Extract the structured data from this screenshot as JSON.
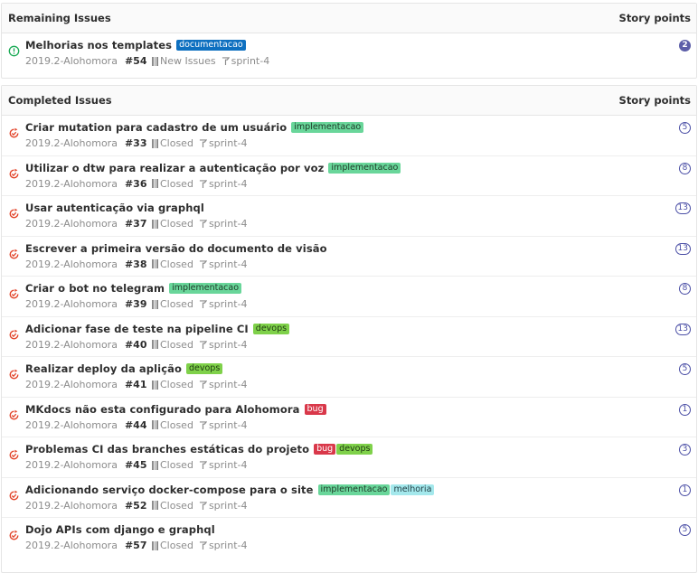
{
  "colors": {
    "open_icon": "#1aaa55",
    "closed_icon": "#e24329",
    "badge": "#4b4fa6"
  },
  "remaining": {
    "title": "Remaining Issues",
    "points_header": "Story points",
    "issues": [
      {
        "title": "Melhorias nos templates",
        "labels": [
          {
            "text": "documentacao",
            "bg": "#0e70c0",
            "fg": "#ffffff"
          }
        ],
        "milestone": "2019.2-Alohomora",
        "iid": "#54",
        "status": "New Issues",
        "sprint": "sprint-4",
        "points": "2"
      }
    ]
  },
  "completed": {
    "title": "Completed Issues",
    "points_header": "Story points",
    "issues": [
      {
        "title": "Criar mutation para cadastro de um usuário",
        "labels": [
          {
            "text": "implementacao",
            "bg": "#69d69a",
            "fg": "#1e3a28"
          }
        ],
        "milestone": "2019.2-Alohomora",
        "iid": "#33",
        "status": "Closed",
        "sprint": "sprint-4",
        "points": "5"
      },
      {
        "title": "Utilizar o dtw para realizar a autenticação por voz",
        "labels": [
          {
            "text": "implementacao",
            "bg": "#69d69a",
            "fg": "#1e3a28"
          }
        ],
        "milestone": "2019.2-Alohomora",
        "iid": "#36",
        "status": "Closed",
        "sprint": "sprint-4",
        "points": "8"
      },
      {
        "title": "Usar autenticação via graphql",
        "labels": [],
        "milestone": "2019.2-Alohomora",
        "iid": "#37",
        "status": "Closed",
        "sprint": "sprint-4",
        "points": "13"
      },
      {
        "title": "Escrever a primeira versão do documento de visão",
        "labels": [],
        "milestone": "2019.2-Alohomora",
        "iid": "#38",
        "status": "Closed",
        "sprint": "sprint-4",
        "points": "13"
      },
      {
        "title": "Criar o bot no telegram",
        "labels": [
          {
            "text": "implementacao",
            "bg": "#69d69a",
            "fg": "#1e3a28"
          }
        ],
        "milestone": "2019.2-Alohomora",
        "iid": "#39",
        "status": "Closed",
        "sprint": "sprint-4",
        "points": "8"
      },
      {
        "title": "Adicionar fase de teste na pipeline CI",
        "labels": [
          {
            "text": "devops",
            "bg": "#7fd14a",
            "fg": "#1e3a12"
          }
        ],
        "milestone": "2019.2-Alohomora",
        "iid": "#40",
        "status": "Closed",
        "sprint": "sprint-4",
        "points": "13"
      },
      {
        "title": "Realizar deploy da aplição",
        "labels": [
          {
            "text": "devops",
            "bg": "#7fd14a",
            "fg": "#1e3a12"
          }
        ],
        "milestone": "2019.2-Alohomora",
        "iid": "#41",
        "status": "Closed",
        "sprint": "sprint-4",
        "points": "5"
      },
      {
        "title": "MKdocs não esta configurado para Alohomora",
        "labels": [
          {
            "text": "bug",
            "bg": "#d9384a",
            "fg": "#ffffff"
          }
        ],
        "milestone": "2019.2-Alohomora",
        "iid": "#44",
        "status": "Closed",
        "sprint": "sprint-4",
        "points": "1"
      },
      {
        "title": "Problemas CI das branches estáticas do projeto",
        "labels": [
          {
            "text": "bug",
            "bg": "#d9384a",
            "fg": "#ffffff"
          },
          {
            "text": "devops",
            "bg": "#7fd14a",
            "fg": "#1e3a12"
          }
        ],
        "milestone": "2019.2-Alohomora",
        "iid": "#45",
        "status": "Closed",
        "sprint": "sprint-4",
        "points": "3"
      },
      {
        "title": "Adicionando serviço docker-compose para o site",
        "labels": [
          {
            "text": "implementacao",
            "bg": "#69d69a",
            "fg": "#1e3a28"
          },
          {
            "text": "melhoria",
            "bg": "#a4e8ec",
            "fg": "#1e3a40"
          }
        ],
        "milestone": "2019.2-Alohomora",
        "iid": "#52",
        "status": "Closed",
        "sprint": "sprint-4",
        "points": "1"
      },
      {
        "title": "Dojo APIs com django e graphql",
        "labels": [],
        "milestone": "2019.2-Alohomora",
        "iid": "#57",
        "status": "Closed",
        "sprint": "sprint-4",
        "points": "5"
      }
    ]
  }
}
